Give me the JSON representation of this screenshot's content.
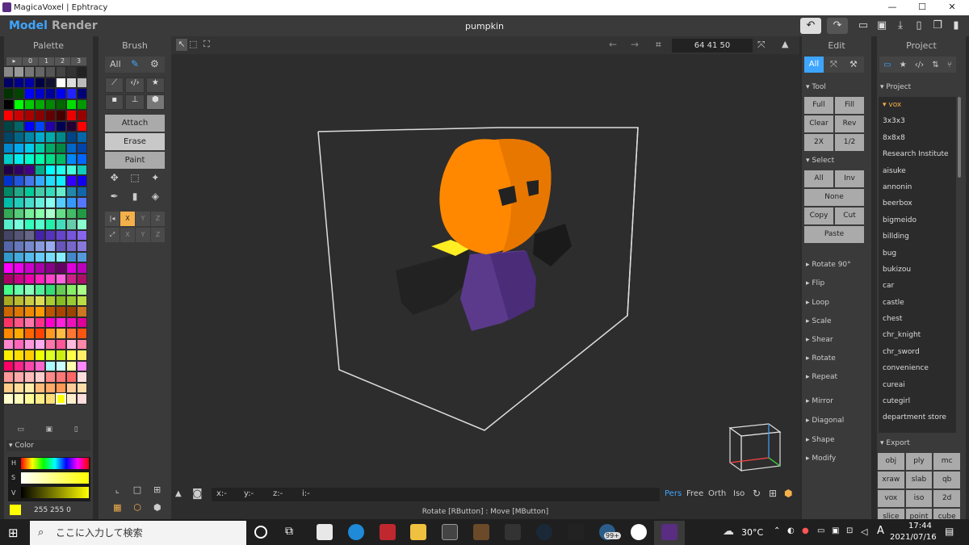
{
  "window": {
    "title": "MagicaVoxel | Ephtracy",
    "minimize": "—",
    "maximize": "☐",
    "close": "✕"
  },
  "top": {
    "model": "Model",
    "render": "Render",
    "file_name": "pumpkin"
  },
  "palette": {
    "title": "Palette",
    "header": [
      "▸",
      "0",
      "1",
      "2",
      "3"
    ],
    "rows": [
      [
        "#888888",
        "#999999",
        "#777777",
        "#666666",
        "#555555",
        "#444444",
        "#333333",
        "#222222"
      ],
      [
        "#000066",
        "#000088",
        "#0000aa",
        "#000044",
        "#111133",
        "#ffffff",
        "#dddddd",
        "#bbbbbb"
      ],
      [
        "#003300",
        "#004400",
        "#0000ff",
        "#0000cc",
        "#000099",
        "#0000ee",
        "#2222ff",
        "#000077"
      ],
      [
        "#000000",
        "#00ff00",
        "#00cc00",
        "#00aa00",
        "#008800",
        "#006600",
        "#00dd00",
        "#009900"
      ],
      [
        "#ff0000",
        "#cc0000",
        "#aa0000",
        "#880000",
        "#660000",
        "#440000",
        "#ee0000",
        "#990000"
      ],
      [
        "#004444",
        "#006666",
        "#0000ff",
        "#0044ff",
        "#2200aa",
        "#000055",
        "#220033",
        "#ff0000"
      ],
      [
        "#004466",
        "#006688",
        "#0088aa",
        "#00aacc",
        "#00aaaa",
        "#008888",
        "#004488",
        "#0066aa"
      ],
      [
        "#0088cc",
        "#00aaee",
        "#00ccee",
        "#00ccaa",
        "#00aa66",
        "#008844",
        "#0066cc",
        "#0044aa"
      ],
      [
        "#00cccc",
        "#00eeee",
        "#00ffcc",
        "#00ffaa",
        "#00dd88",
        "#00bb66",
        "#0088ff",
        "#0066ff"
      ],
      [
        "#220044",
        "#330066",
        "#440088",
        "#00aa88",
        "#00ffff",
        "#22ffee",
        "#44ffdd",
        "#11ccbb"
      ],
      [
        "#0033cc",
        "#2255dd",
        "#4477ee",
        "#33aaff",
        "#22ddff",
        "#11eeff",
        "#3300ff",
        "#1100ee"
      ],
      [
        "#008866",
        "#22aa88",
        "#00cc99",
        "#44ccaa",
        "#33ddbb",
        "#66eecc",
        "#2288aa",
        "#1166aa"
      ],
      [
        "#00bbaa",
        "#22ccbb",
        "#44ddcc",
        "#66eedd",
        "#88ffee",
        "#55ccff",
        "#3399ff",
        "#5577ff"
      ],
      [
        "#33aa55",
        "#55cc77",
        "#77ee99",
        "#88ffaa",
        "#aaffcc",
        "#66dd88",
        "#44bb66",
        "#229944"
      ],
      [
        "#55eecc",
        "#77ffdd",
        "#33ffbb",
        "#55ffcc",
        "#22eeaa",
        "#44ddbb",
        "#66ccaa",
        "#88ffcc"
      ],
      [
        "#444466",
        "#555577",
        "#666688",
        "#4422aa",
        "#5533bb",
        "#6644cc",
        "#7755dd",
        "#8866ee"
      ],
      [
        "#5566aa",
        "#6677bb",
        "#7788cc",
        "#8899dd",
        "#99aaee",
        "#6655bb",
        "#7766cc",
        "#8877dd"
      ],
      [
        "#3399cc",
        "#44aadd",
        "#55bbee",
        "#66ccff",
        "#77ddff",
        "#88eeff",
        "#4488cc",
        "#5599dd"
      ],
      [
        "#ff00ff",
        "#ee00ee",
        "#cc00cc",
        "#aa00aa",
        "#880088",
        "#660066",
        "#dd00dd",
        "#bb00bb"
      ],
      [
        "#aa0066",
        "#cc0088",
        "#ee00aa",
        "#ff22bb",
        "#ff44cc",
        "#ff66dd",
        "#cc2288",
        "#aa1166"
      ],
      [
        "#44ff88",
        "#66ffaa",
        "#88ffbb",
        "#55ee99",
        "#33dd77",
        "#66cc55",
        "#88ee66",
        "#aaff88"
      ],
      [
        "#aaaa22",
        "#bbbb33",
        "#cccc44",
        "#dddd55",
        "#aacc33",
        "#88bb22",
        "#99cc33",
        "#bbdd44"
      ],
      [
        "#cc6600",
        "#dd7700",
        "#ee8800",
        "#ff9900",
        "#bb5500",
        "#aa4400",
        "#994400",
        "#cc7722"
      ],
      [
        "#ff3366",
        "#ff5588",
        "#ff77aa",
        "#ff3388",
        "#ff00cc",
        "#ff22dd",
        "#ee11bb",
        "#dd0099"
      ],
      [
        "#ff8800",
        "#ffaa00",
        "#ff6600",
        "#ff4400",
        "#ff9922",
        "#ffbb44",
        "#ff7733",
        "#ff5511"
      ],
      [
        "#ff88cc",
        "#ff66bb",
        "#ff99dd",
        "#ffaaee",
        "#ff77aa",
        "#ff5599",
        "#ffbbdd",
        "#ff88aa"
      ],
      [
        "#ffee00",
        "#ffdd00",
        "#ffcc00",
        "#eeff00",
        "#ddff22",
        "#ccee11",
        "#ffff44",
        "#ffee66"
      ],
      [
        "#ff0066",
        "#ff2288",
        "#ff44aa",
        "#ff66cc",
        "#aaffff",
        "#ccffff",
        "#ffffaa",
        "#ff88ff"
      ],
      [
        "#ff9999",
        "#ffaaaa",
        "#ffbbbb",
        "#ffcccc",
        "#ff8888",
        "#ff7777",
        "#ff6666",
        "#ffdddd"
      ],
      [
        "#ffcc88",
        "#ffdd99",
        "#ffeeaa",
        "#ffbb77",
        "#ffaa66",
        "#ff9955",
        "#ffcc99",
        "#ffddaa"
      ],
      [
        "#ffffcc",
        "#ffffbb",
        "#ffff99",
        "#ffee88",
        "#ffdd77",
        "#ffff00",
        "#ffeecc",
        "#ffdddd"
      ]
    ],
    "color_section": "▾ Color",
    "hsv_labels": [
      "H",
      "S",
      "V"
    ],
    "rgb_value": "255 255 0",
    "selected_color": "#ffff00"
  },
  "brush": {
    "title": "Brush",
    "all_label": "All",
    "attach": "Attach",
    "erase": "Erase",
    "paint": "Paint",
    "axis": [
      "X",
      "Y",
      "Z"
    ]
  },
  "viewport": {
    "coords": "64  41  50",
    "status_fields": [
      "x:-",
      "y:-",
      "z:-",
      "i:-"
    ],
    "camera_modes": [
      "Pers",
      "Free",
      "Orth",
      "Iso"
    ],
    "status_text": "Rotate [RButton] : Move [MButton]"
  },
  "edit": {
    "title": "Edit",
    "all_label": "All",
    "tool_section": "▾ Tool",
    "tool_buttons": [
      "Full",
      "Fill",
      "Clear",
      "Rev",
      "2X",
      "1/2"
    ],
    "select_section": "▾ Select",
    "select_buttons": [
      "All",
      "Inv",
      "None",
      "Copy",
      "Cut",
      "Paste"
    ],
    "sections": [
      "▸ Rotate 90°",
      "▸ Flip",
      "▸ Loop",
      "▸ Scale",
      "▸ Shear",
      "▸ Rotate",
      "▸ Repeat",
      "▸ Mirror",
      "▸ Diagonal",
      "▸ Shape",
      "▸ Modify"
    ]
  },
  "project": {
    "title": "Project",
    "section": "▾ Project",
    "items": [
      "▾ vox",
      "3x3x3",
      "8x8x8",
      "Research Institute",
      "aisuke",
      "annonin",
      "beerbox",
      "bigmeido",
      "billding",
      "bug",
      "bukizou",
      "car",
      "castle",
      "chest",
      "chr_knight",
      "chr_sword",
      "convenience",
      "cureai",
      "cutegirl",
      "department store"
    ],
    "export_section": "▾ Export",
    "export_buttons": [
      "obj",
      "ply",
      "mc",
      "xraw",
      "slab",
      "qb",
      "vox",
      "iso",
      "2d",
      "slice",
      "point",
      "cube"
    ]
  },
  "taskbar": {
    "search_placeholder": "ここに入力して検索",
    "weather": "30°C",
    "time": "17:44",
    "date": "2021/07/16",
    "badge": "99+",
    "ime": "A"
  },
  "colors": {
    "accent": "#3da5ff",
    "pumpkin": "#ff8800",
    "body": "#5b3a8c",
    "yellow": "#ffff00"
  }
}
